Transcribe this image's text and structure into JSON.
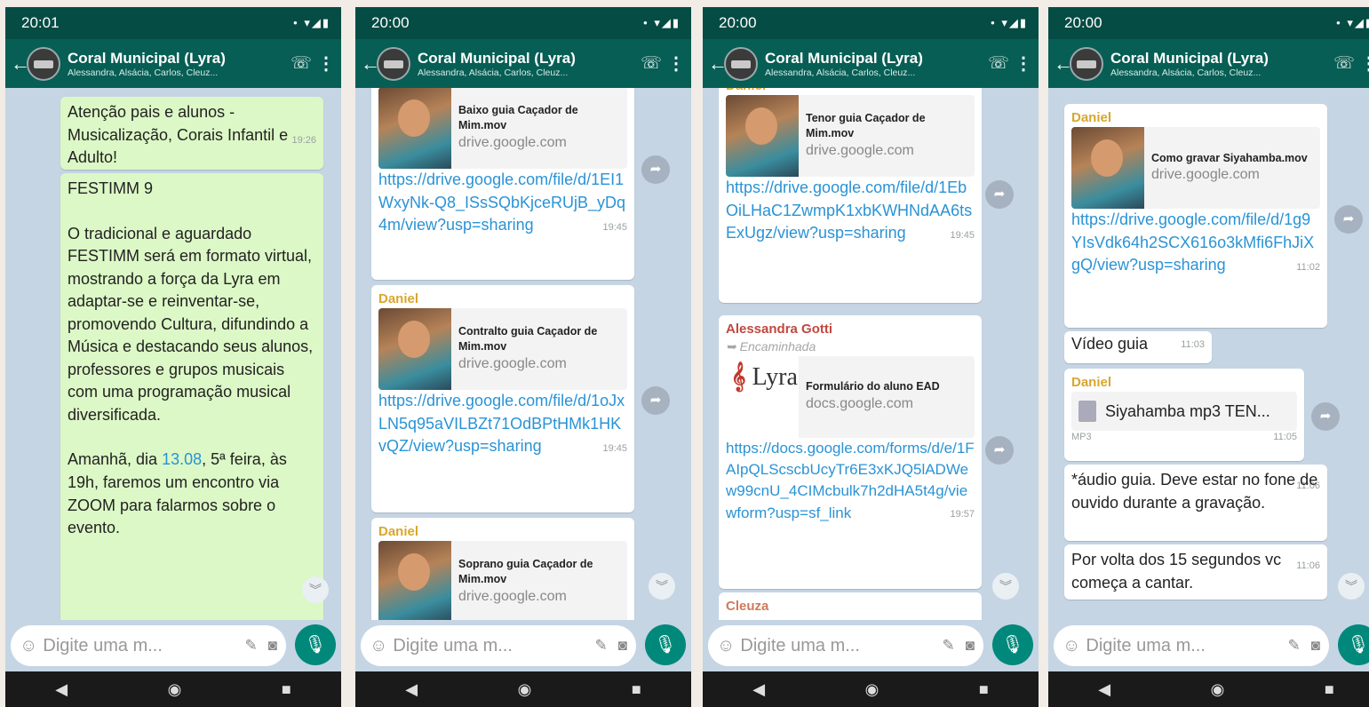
{
  "common": {
    "group_title": "Coral Municipal (Lyra)",
    "group_subtitle": "Alessandra, Alsácia, Carlos, Cleuz...",
    "input_placeholder": "Digite uma m...",
    "icons": {
      "back": "arrow-left",
      "call": "add-call",
      "menu": "more-vert",
      "emoji": "emoji",
      "attach": "paperclip",
      "camera": "camera",
      "mic": "microphone",
      "forward": "share-arrow",
      "scroll": "double-chevron-down"
    },
    "nav": {
      "back": "◀",
      "home": "◉",
      "recent": "■"
    }
  },
  "phones": [
    {
      "time": "20:01",
      "messages": {
        "m1_text": "Atenção pais e alunos - Musicalização, Corais Infantil e Adulto!",
        "m1_time": "19:26",
        "m2_title": "FESTIMM 9",
        "m2_body": "O tradicional e aguardado FESTIMM será em formato virtual, mostrando a força da Lyra em adaptar-se e reinventar-se, promovendo Cultura, difundindo a Música e destacando seus alunos, professores e grupos musicais com uma programação musical diversificada.",
        "m2_tail_a": "Amanhã, dia ",
        "m2_date": "13.08",
        "m2_tail_b": ", 5ª feira, às 19h, faremos um encontro via ZOOM para  falarmos sobre o evento."
      }
    },
    {
      "time": "20:00",
      "messages": {
        "p1_title": "Baixo guia Caçador de Mim.mov",
        "p1_domain": "drive.google.com",
        "p1_link": "https://drive.google.com/file/d/1EI1WxyNk-Q8_ISsSQbKjceRUjB_yDq4m/view?usp=sharing",
        "p1_time": "19:45",
        "s2": "Daniel",
        "p2_title": "Contralto guia Caçador de Mim.mov",
        "p2_domain": "drive.google.com",
        "p2_link": "https://drive.google.com/file/d/1oJxLN5q95aVILBZt71OdBPtHMk1HKvQZ/view?usp=sharing",
        "p2_time": "19:45",
        "s3": "Daniel",
        "p3_title": "Soprano guia Caçador de Mim.mov",
        "p3_domain": "drive.google.com"
      }
    },
    {
      "time": "20:00",
      "messages": {
        "s0": "Daniel",
        "p1_title": "Tenor guia Caçador de Mim.mov",
        "p1_domain": "drive.google.com",
        "p1_link": "https://drive.google.com/file/d/1EbOiLHaC1ZwmpK1xbKWHNdAA6tsExUgz/view?usp=sharing",
        "p1_time": "19:45",
        "s2": "Alessandra Gotti",
        "fwd": "Encaminhada",
        "lyra": "Lyra",
        "p2_title": "Formulário do aluno EAD",
        "p2_domain": "docs.google.com",
        "p2_link": "https://docs.google.com/forms/d/e/1FAIpQLScscbUcyTr6E3xKJQ5lADWew99cnU_4CIMcbulk7h2dHA5t4g/viewform?usp=sf_link",
        "p2_time": "19:57",
        "s3": "Cleuza"
      }
    },
    {
      "time": "20:00",
      "messages": {
        "s1": "Daniel",
        "p1_title": "Como gravar Siyahamba.mov",
        "p1_domain": "drive.google.com",
        "p1_link": "https://drive.google.com/file/d/1g9YIsVdk64h2SCX616o3kMfi6FhJiXgQ/view?usp=sharing",
        "p1_time": "11:02",
        "m2_text": "Vídeo guia",
        "m2_time": "11:03",
        "s3": "Daniel",
        "doc_name": "Siyahamba mp3 TEN...",
        "doc_type": "MP3",
        "doc_time": "11:05",
        "m4_text": "*áudio guia. Deve estar no fone de ouvido durante a gravação.",
        "m4_time": "11:06",
        "m5_text": "Por volta dos 15 segundos vc começa a cantar.",
        "m5_time": "11:06"
      }
    }
  ]
}
